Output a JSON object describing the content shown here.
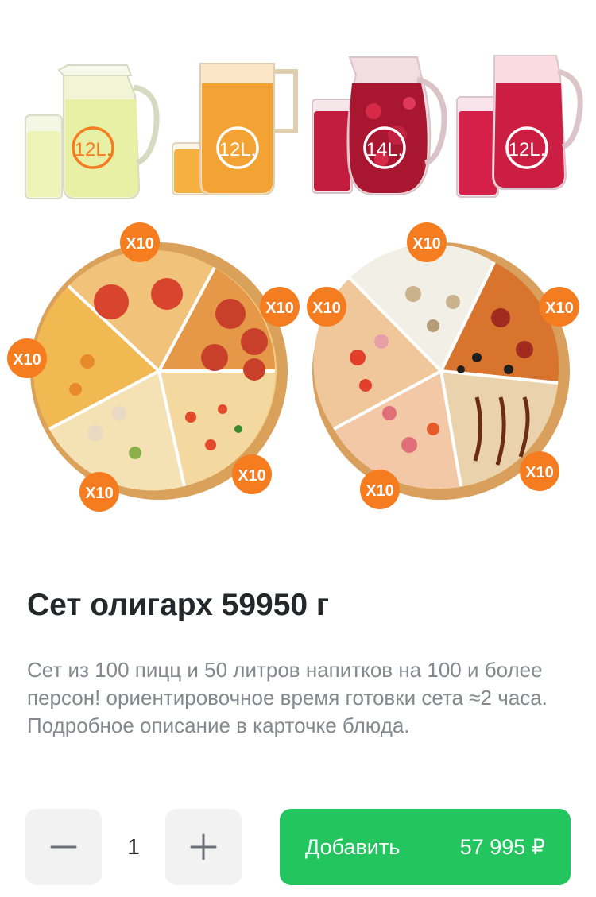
{
  "product": {
    "title": "Сет олигарх 59950 г",
    "description": "Сет из 100 пицц и 50 литров напитков на 100 и более персон! ориентировочное время готовки сета ≈2 часа. Подробное описание в карточке блюда."
  },
  "drinks": [
    {
      "volume": "12L.",
      "color": "#e6f0b6"
    },
    {
      "volume": "12L.",
      "color": "#f2a53a"
    },
    {
      "volume": "14L.",
      "color": "#b81e3a"
    },
    {
      "volume": "12L.",
      "color": "#d11f44"
    }
  ],
  "pizza_badges": [
    "X10",
    "X10",
    "X10",
    "X10",
    "X10",
    "X10",
    "X10",
    "X10",
    "X10",
    "X10"
  ],
  "cart": {
    "quantity": "1",
    "add_label": "Добавить",
    "price": "57 995 ₽"
  },
  "colors": {
    "accent": "#22c55e",
    "badge": "#f57c1f",
    "title": "#25272b",
    "description": "#85888e"
  }
}
